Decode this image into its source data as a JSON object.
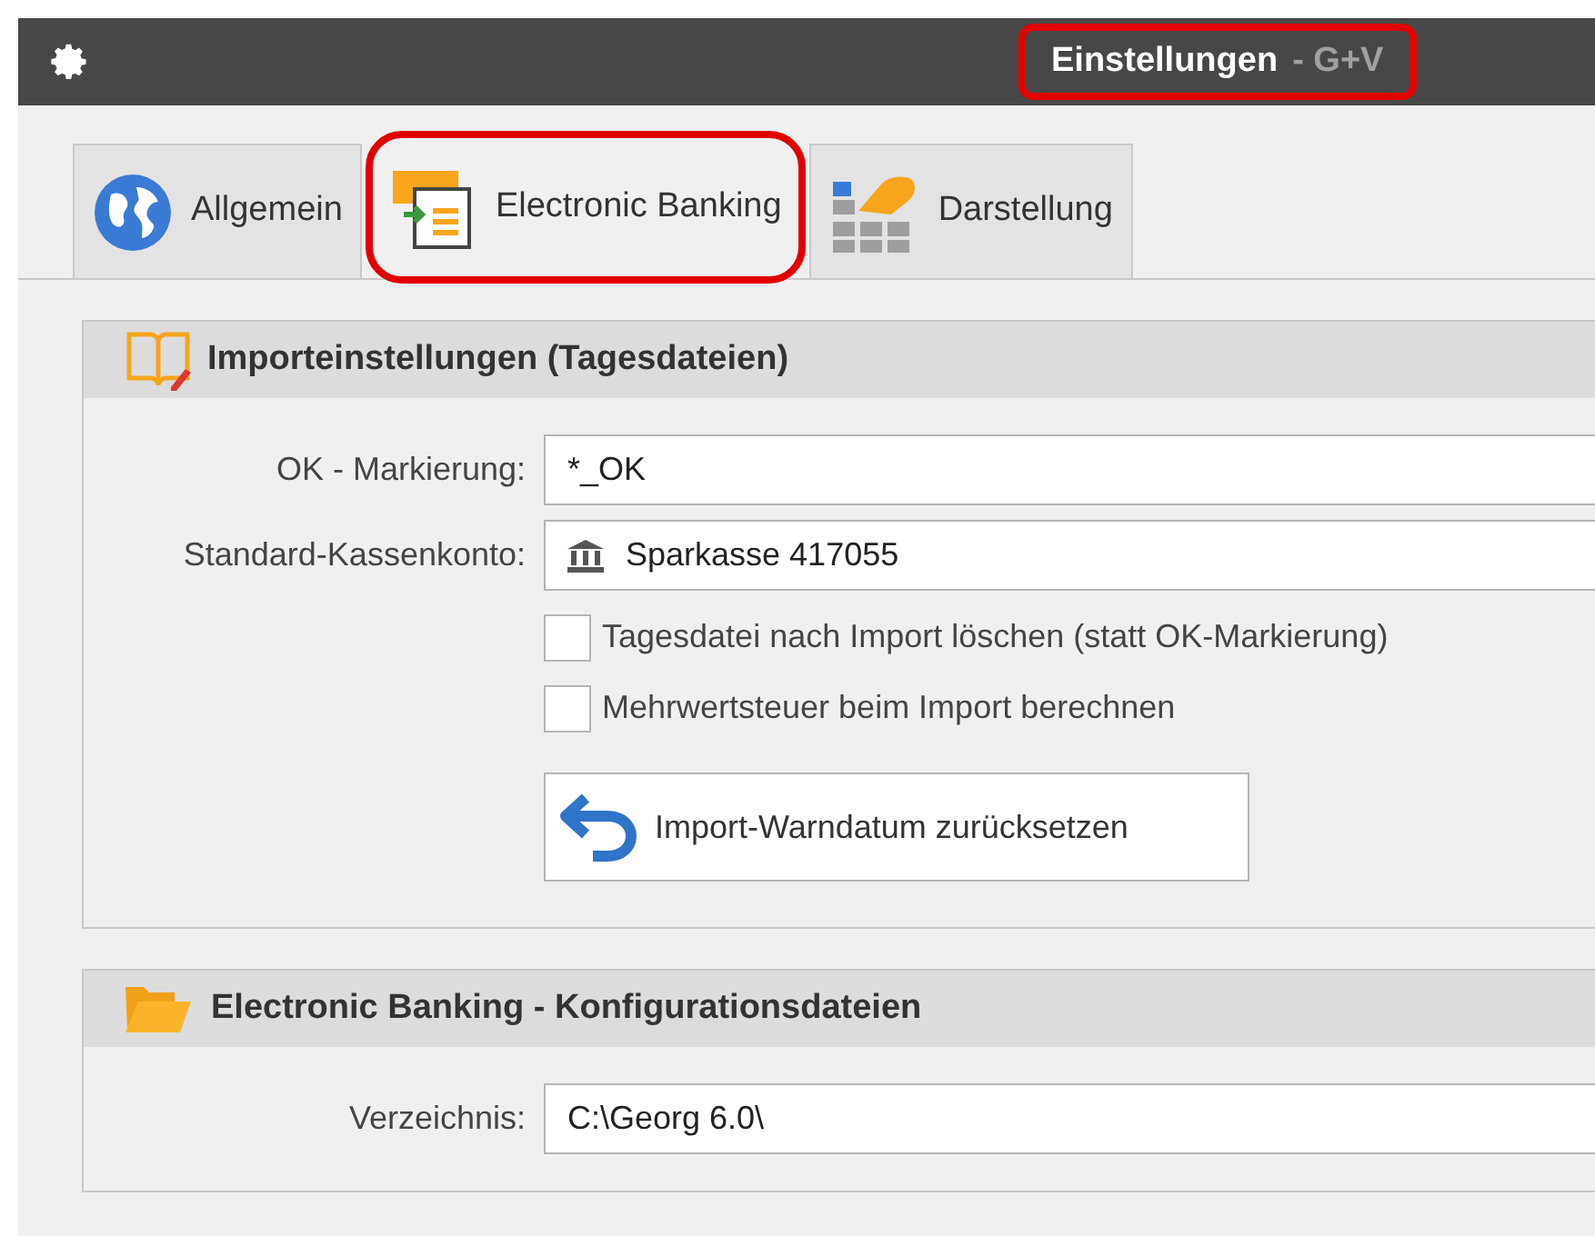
{
  "window": {
    "title": "Einstellungen",
    "subtitle": "- G+V",
    "highlighted": true
  },
  "tabs": [
    {
      "label": "Allgemein",
      "kind": "globe",
      "selected": false,
      "highlighted": false
    },
    {
      "label": "Electronic Banking",
      "kind": "banking",
      "selected": true,
      "highlighted": true
    },
    {
      "label": "Darstellung",
      "kind": "display",
      "selected": false,
      "highlighted": false
    }
  ],
  "import_section": {
    "title": "Importeinstellungen (Tagesdateien)",
    "fields": [
      {
        "label": "OK - Markierung:",
        "value": "*_OK",
        "kind": "text"
      },
      {
        "label": "Standard-Kassenkonto:",
        "value": "Sparkasse 417055",
        "kind": "account"
      }
    ],
    "checkboxes": [
      {
        "label": "Tagesdatei nach Import löschen (statt OK-Markierung)",
        "checked": false
      },
      {
        "label": "Mehrwertsteuer beim Import berechnen",
        "checked": false
      }
    ],
    "button": "Import-Warndatum zurücksetzen"
  },
  "config_section": {
    "title_main": "Electronic Banking",
    "title_rest": "- Konfigurationsdateien",
    "fields": [
      {
        "label": "Verzeichnis:",
        "value": "C:\\Georg 6.0\\",
        "kind": "text"
      }
    ]
  }
}
